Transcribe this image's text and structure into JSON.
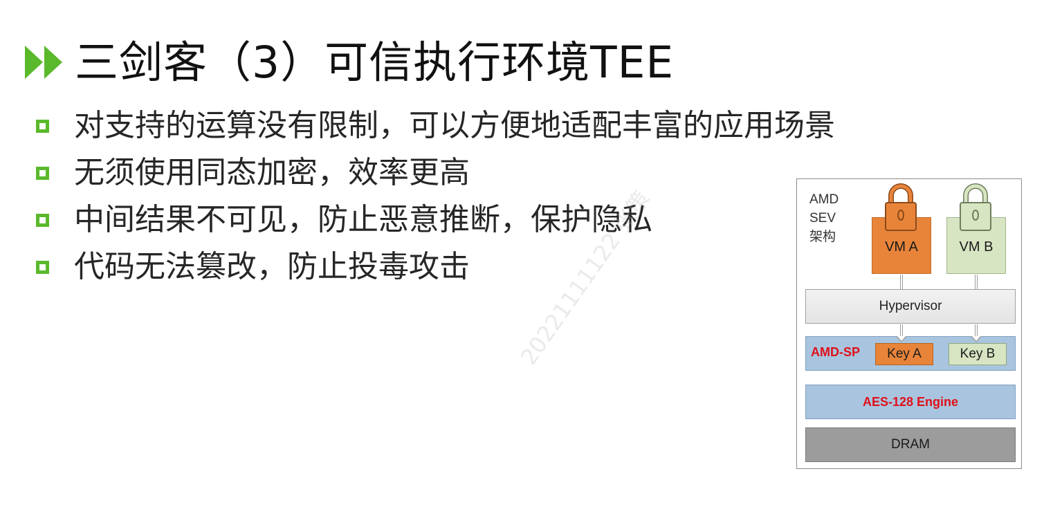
{
  "title": {
    "text": "三剑客（3）可信执行环境TEE",
    "icon": "double-chevron-right-icon",
    "icon_color": "#5ab92b"
  },
  "bullets": [
    {
      "text": "对支持的运算没有限制，可以方便地适配丰富的应用场景"
    },
    {
      "text": "无须使用同态加密，效率更高"
    },
    {
      "text": "中间结果不可见，防止恶意推断，保护隐私"
    },
    {
      "text": "代码无法篡改，防止投毒攻击"
    }
  ],
  "bullet_marker": {
    "icon": "hollow-square-icon",
    "color": "#5ab92b"
  },
  "watermark": {
    "text": "20221111122 张策"
  },
  "diagram": {
    "label": "AMD\nSEV\n架构",
    "vm_a": {
      "label": "VM A",
      "color": "#e8843a",
      "lock_icon": "padlock-orange-icon"
    },
    "vm_b": {
      "label": "VM B",
      "color": "#d8e5c3",
      "lock_icon": "padlock-green-icon"
    },
    "hypervisor": "Hypervisor",
    "amd_sp": "AMD-SP",
    "key_a": "Key A",
    "key_b": "Key B",
    "aes_engine": "AES-128 Engine",
    "dram": "DRAM",
    "accent_red": "#e0101a",
    "blue_box": "#a9c4de",
    "dram_gray": "#9c9c9c"
  }
}
